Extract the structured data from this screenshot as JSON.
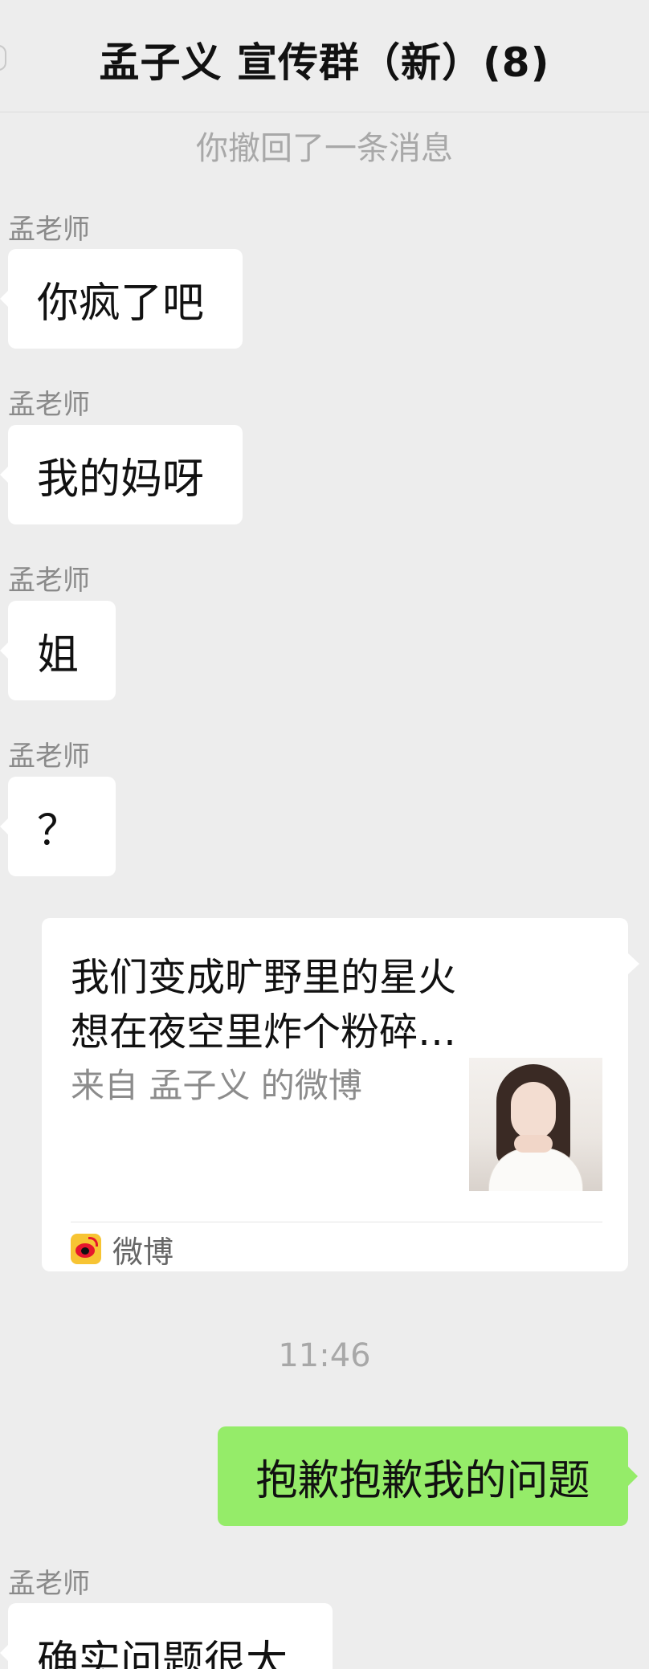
{
  "header": {
    "title": "孟子义 宣传群（新）(8)"
  },
  "system_notice": "你撤回了一条消息",
  "messages": [
    {
      "sender": "孟老师",
      "text": "你疯了吧"
    },
    {
      "sender": "孟老师",
      "text": "我的妈呀"
    },
    {
      "sender": "孟老师",
      "text": "姐"
    },
    {
      "sender": "孟老师",
      "text": "？"
    }
  ],
  "share_card": {
    "title_line1": "我们变成旷野里的星火",
    "title_line2": "想在夜空里炸个粉碎…",
    "source": "来自 孟子义 的微博",
    "footer_label": "微博",
    "thumbnail_icon": "portrait-photo"
  },
  "timestamp": "11:46",
  "outgoing_message": "抱歉抱歉我的问题",
  "last_message": {
    "sender": "孟老师",
    "text": "确实问题很大"
  },
  "colors": {
    "background": "#ededed",
    "incoming_bubble": "#ffffff",
    "outgoing_bubble": "#95ec69",
    "meta_text": "#a8a8a8"
  }
}
